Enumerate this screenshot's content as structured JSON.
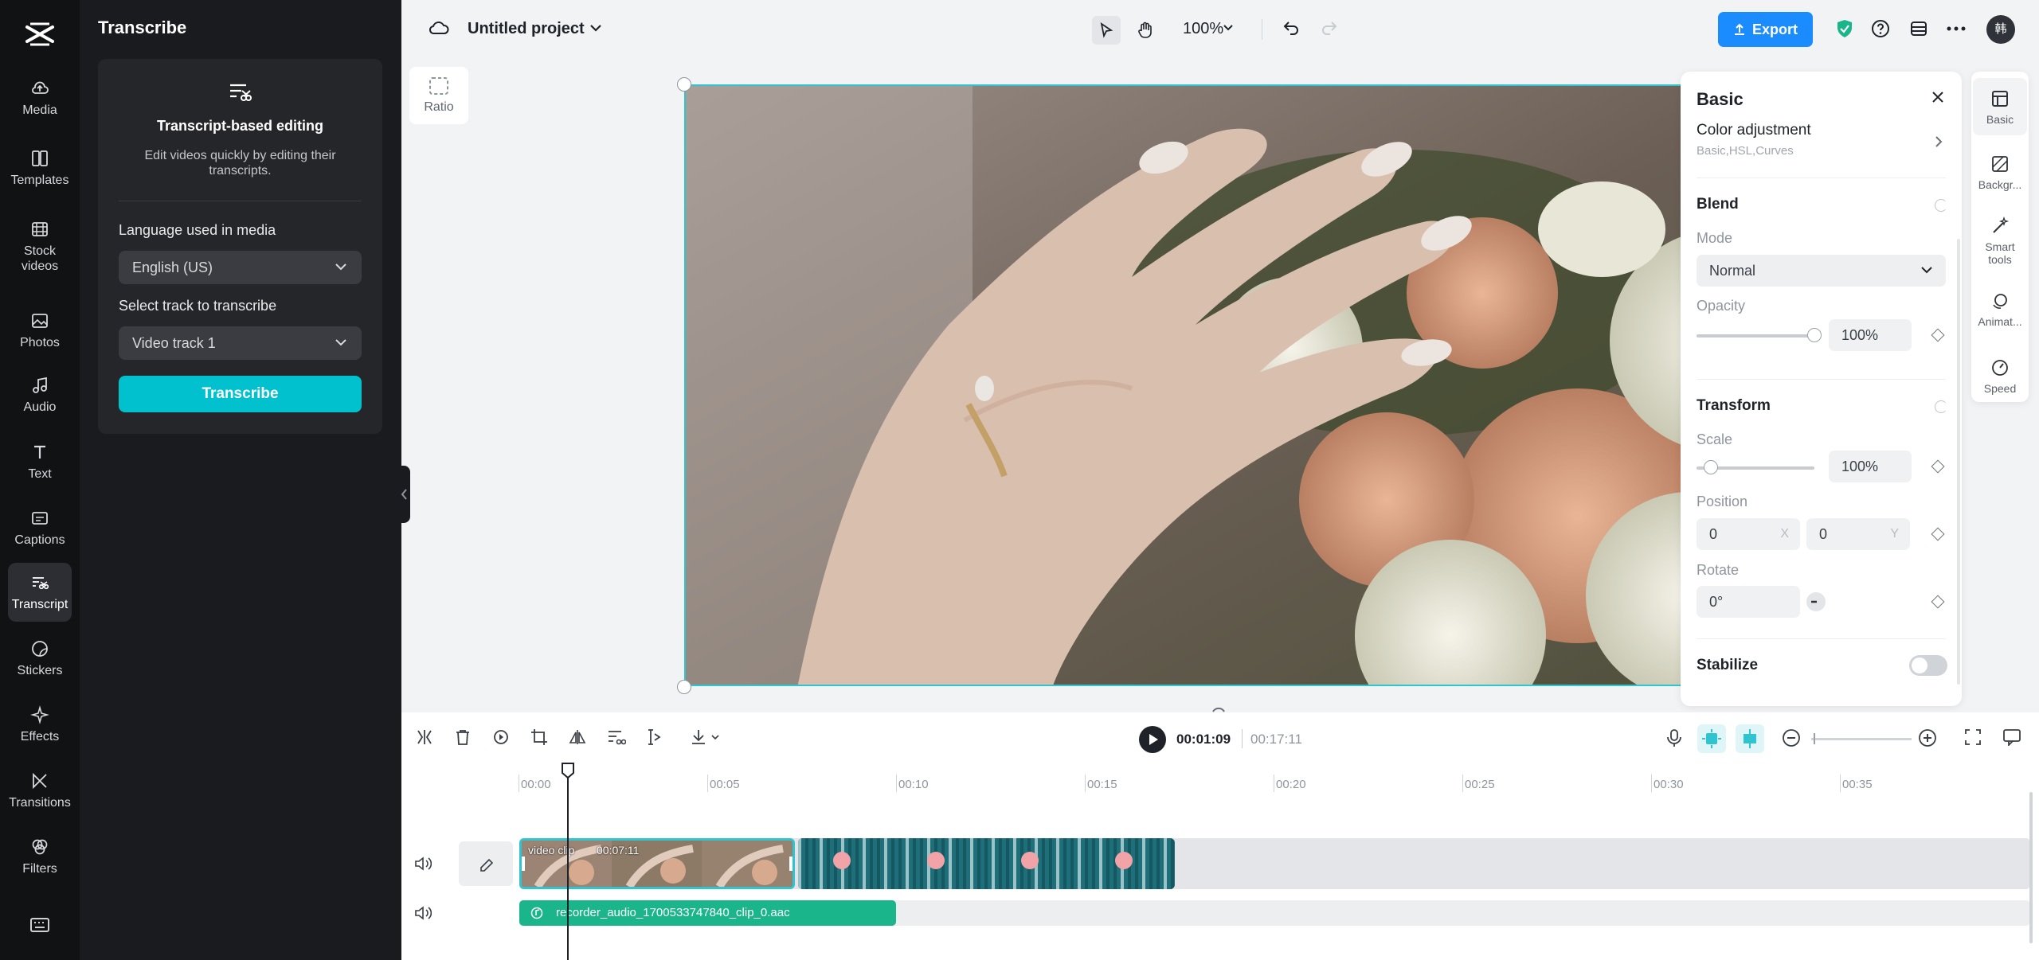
{
  "rail": {
    "items": [
      {
        "label": "Media",
        "icon": "cloud-upload-icon"
      },
      {
        "label": "Templates",
        "icon": "templates-icon"
      },
      {
        "label": "Stock videos",
        "icon": "film-icon"
      },
      {
        "label": "Photos",
        "icon": "image-icon"
      },
      {
        "label": "Audio",
        "icon": "music-icon"
      },
      {
        "label": "Text",
        "icon": "text-icon"
      },
      {
        "label": "Captions",
        "icon": "captions-icon"
      },
      {
        "label": "Transcript",
        "icon": "transcript-icon",
        "active": true
      },
      {
        "label": "Stickers",
        "icon": "sticker-icon"
      },
      {
        "label": "Effects",
        "icon": "sparkle-icon"
      },
      {
        "label": "Transitions",
        "icon": "transition-icon"
      },
      {
        "label": "Filters",
        "icon": "filter-icon"
      }
    ]
  },
  "panel": {
    "title": "Transcribe",
    "card_title": "Transcript-based editing",
    "card_desc": "Edit videos quickly by editing their transcripts.",
    "language_label": "Language used in media",
    "language_value": "English (US)",
    "track_label": "Select track to transcribe",
    "track_value": "Video track 1",
    "button": "Transcribe"
  },
  "topbar": {
    "project": "Untitled project",
    "zoom": "100%",
    "export": "Export"
  },
  "canvas": {
    "ratio": "Ratio"
  },
  "basic": {
    "title": "Basic",
    "color_adjustment": "Color adjustment",
    "color_adjustment_sub": "Basic,HSL,Curves",
    "blend": "Blend",
    "mode_label": "Mode",
    "mode_value": "Normal",
    "opacity_label": "Opacity",
    "opacity_value": "100%",
    "opacity_level": 1.0,
    "transform": "Transform",
    "scale_label": "Scale",
    "scale_value": "100%",
    "scale_level": 0.12,
    "position_label": "Position",
    "pos_x": "0",
    "pos_x_axis": "X",
    "pos_y": "0",
    "pos_y_axis": "Y",
    "rotate_label": "Rotate",
    "rotate_value": "0°",
    "stabilize": "Stabilize"
  },
  "right_tabs": [
    {
      "label": "Basic",
      "icon": "basic-icon",
      "active": true
    },
    {
      "label": "Backgr...",
      "icon": "background-icon"
    },
    {
      "label": "Smart tools",
      "icon": "magic-wand-icon"
    },
    {
      "label": "Animat...",
      "icon": "animation-icon"
    },
    {
      "label": "Speed",
      "icon": "speed-icon"
    }
  ],
  "timeline": {
    "current_time": "00:01:09",
    "total_time": "00:17:11",
    "ticks": [
      "00:00",
      "00:05",
      "00:10",
      "00:15",
      "00:20",
      "00:25",
      "00:30",
      "00:35"
    ],
    "video_clip_label": "video clip",
    "video_clip_duration": "00:07:11",
    "audio_clip_label": "recorder_audio_1700533747840_clip_0.aac"
  },
  "colors": {
    "accent": "#00c1cd",
    "export": "#1a8cff",
    "selection": "#2fc4d0"
  }
}
